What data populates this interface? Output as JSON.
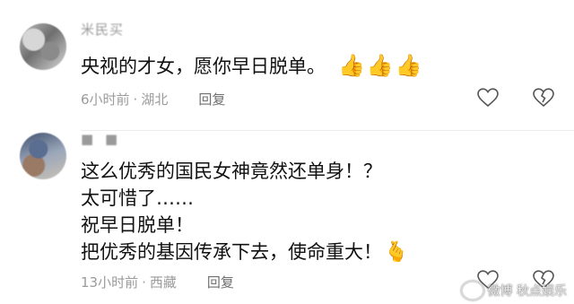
{
  "comments": [
    {
      "username": "米民买",
      "text_lines": [
        "央视的才女，愿你早日脱单。"
      ],
      "emoji": [
        "thumbs-up-icon",
        "thumbs-up-icon",
        "thumbs-up-icon"
      ],
      "time": "6小时前",
      "location": "湖北",
      "reply_label": "回复"
    },
    {
      "username": "■ ■",
      "text_lines": [
        "这么优秀的国民女神竟然还单身！？",
        "太可惜了……",
        "祝早日脱单！",
        "把优秀的基因传承下去，使命重大！"
      ],
      "emoji": [
        "crossed-fingers-heart-icon"
      ],
      "time": "13小时前",
      "location": "西藏",
      "reply_label": "回复"
    }
  ],
  "separator": "·",
  "watermark": "微博 秋点娱乐",
  "colors": {
    "meta": "#9b9b9b",
    "thumb": "#f0a11b",
    "text": "#111111"
  }
}
